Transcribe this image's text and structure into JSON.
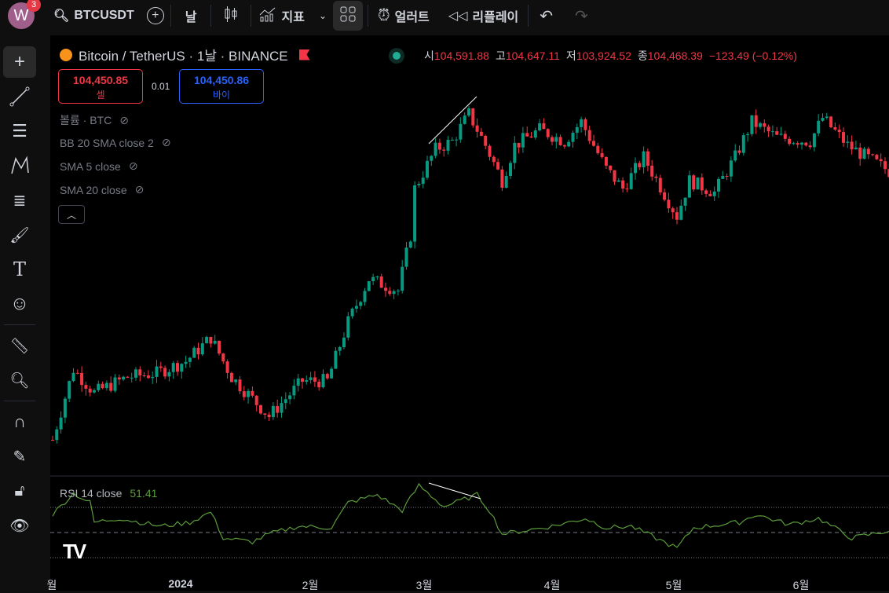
{
  "topbar": {
    "avatar_letter": "W",
    "notifications": "3",
    "symbol": "BTCUSDT",
    "interval": "날",
    "indicators": "지표",
    "alert": "얼러트",
    "replay": "리플레이"
  },
  "legend": {
    "title": "Bitcoin / TetherUS · 1날 · BINANCE",
    "open_label": "시",
    "open": "104,591.88",
    "high_label": "고",
    "high": "104,647.11",
    "low_label": "저",
    "low": "103,924.52",
    "close_label": "종",
    "close": "104,468.39",
    "change": "−123.49 (−0.12%)"
  },
  "sell": {
    "price": "104,450.85",
    "label": "셀"
  },
  "spread": "0.01",
  "buy": {
    "price": "104,450.86",
    "label": "바이"
  },
  "indicators": [
    "볼륨 · BTC",
    "BB 20 SMA close 2",
    "SMA 5 close",
    "SMA 20 close"
  ],
  "rsi": {
    "label": "RSI 14 close",
    "value": "51.41"
  },
  "time_axis": [
    "월",
    "2024",
    "2월",
    "3월",
    "4월",
    "5월",
    "6월"
  ],
  "colors": {
    "up": "#089981",
    "down": "#f23645",
    "rsi": "#5b9c3a",
    "bg": "#000000"
  },
  "chart_data": {
    "type": "candlestick",
    "interval": "1D",
    "keypoints_day": [
      0,
      5,
      10,
      18,
      25,
      32,
      38,
      43,
      52,
      60,
      66,
      71,
      76,
      83,
      86,
      87,
      92,
      96,
      100,
      104,
      108,
      111,
      117,
      123,
      127,
      133,
      137,
      142,
      150,
      153,
      159,
      164,
      168,
      174,
      182,
      185,
      191,
      201
    ],
    "keypoints_close": [
      41000,
      47950,
      45630,
      47180,
      47560,
      48720,
      51040,
      47180,
      43320,
      46790,
      46790,
      52580,
      56830,
      55670,
      61070,
      65700,
      69560,
      70340,
      73040,
      69950,
      66480,
      69950,
      71490,
      70340,
      72270,
      67630,
      65700,
      68790,
      63000,
      66480,
      65320,
      68790,
      72270,
      70720,
      70340,
      72650,
      69950,
      67400
    ],
    "rsi_keypoints_day": [
      0,
      5,
      9,
      10,
      16,
      26,
      33,
      38,
      41,
      48,
      52,
      59,
      67,
      71,
      78,
      84,
      88,
      94,
      102,
      105,
      108,
      120,
      128,
      133,
      139,
      150,
      154,
      165,
      169,
      177,
      184,
      192,
      201
    ],
    "rsi_values": [
      64.4,
      81.3,
      73.8,
      58.1,
      61.3,
      55,
      58.1,
      66.3,
      45.6,
      42.5,
      48.8,
      55,
      53.8,
      73.8,
      80,
      67.5,
      87.5,
      70.6,
      80,
      67.5,
      48.8,
      55,
      61.3,
      53.8,
      55,
      37.5,
      53.8,
      58.1,
      64.4,
      56.3,
      61.3,
      45.6,
      51.4
    ],
    "rsi_levels": [
      70,
      50,
      30
    ]
  }
}
